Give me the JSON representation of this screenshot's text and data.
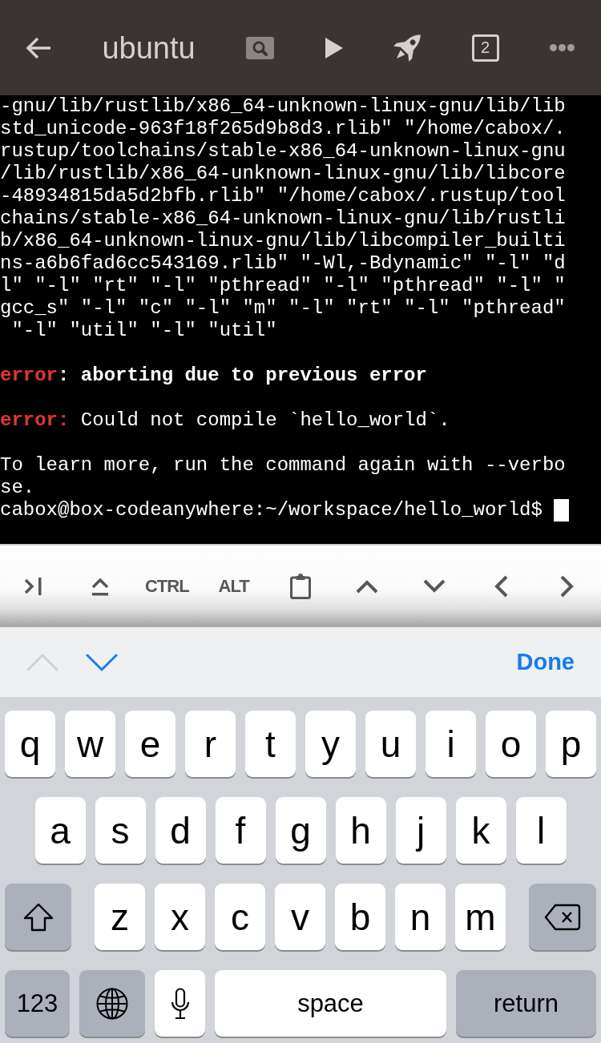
{
  "top_bar": {
    "title": "ubuntu",
    "tab_count": "2"
  },
  "terminal": {
    "blocks": [
      {
        "lines": [
          {
            "kind": "output",
            "text": "-gnu/lib/rustlib/x86_64-unknown-linux-gnu/lib/lib"
          },
          {
            "kind": "output",
            "text": "std_unicode-963f18f265d9b8d3.rlib\" \"/home/cabox/."
          },
          {
            "kind": "output",
            "text": "rustup/toolchains/stable-x86_64-unknown-linux-gnu"
          },
          {
            "kind": "output",
            "text": "/lib/rustlib/x86_64-unknown-linux-gnu/lib/libcore"
          },
          {
            "kind": "output",
            "text": "-48934815da5d2bfb.rlib\" \"/home/cabox/.rustup/tool"
          },
          {
            "kind": "output",
            "text": "chains/stable-x86_64-unknown-linux-gnu/lib/rustli"
          },
          {
            "kind": "output",
            "text": "b/x86_64-unknown-linux-gnu/lib/libcompiler_builti"
          },
          {
            "kind": "output",
            "text": "ns-a6b6fad6cc543169.rlib\" \"-Wl,-Bdynamic\" \"-l\" \"d"
          },
          {
            "kind": "output",
            "text": "l\" \"-l\" \"rt\" \"-l\" \"pthread\" \"-l\" \"pthread\" \"-l\" \""
          },
          {
            "kind": "output",
            "text": "gcc_s\" \"-l\" \"c\" \"-l\" \"m\" \"-l\" \"rt\" \"-l\" \"pthread\""
          },
          {
            "kind": "output",
            "text": " \"-l\" \"util\" \"-l\" \"util\""
          }
        ]
      },
      {
        "lines": [
          {
            "kind": "error",
            "label": "error",
            "message": ": aborting due to previous error",
            "bold": true
          }
        ]
      },
      {
        "lines": [
          {
            "kind": "error",
            "label": "error:",
            "message": " Could not compile `hello_world`.",
            "bold": false
          }
        ]
      },
      {
        "lines": [
          {
            "kind": "output",
            "text": "To learn more, run the command again with --verbo"
          },
          {
            "kind": "output",
            "text": "se."
          },
          {
            "kind": "prompt",
            "text": "cabox@box-codeanywhere:~/workspace/hello_world$",
            "cursor": true
          }
        ]
      }
    ]
  },
  "terminal_toolbar": {
    "modifier_keys": [
      {
        "label": "CTRL"
      },
      {
        "label": "ALT"
      }
    ]
  },
  "form_bar": {
    "previous": {
      "disabled": true
    },
    "next": {
      "disabled": false
    },
    "done": "Done"
  },
  "keyboard": {
    "rows": [
      {
        "keys": [
          {
            "kind": "letter",
            "label": "q"
          },
          {
            "kind": "letter",
            "label": "w"
          },
          {
            "kind": "letter",
            "label": "e"
          },
          {
            "kind": "letter",
            "label": "r"
          },
          {
            "kind": "letter",
            "label": "t"
          },
          {
            "kind": "letter",
            "label": "y"
          },
          {
            "kind": "letter",
            "label": "u"
          },
          {
            "kind": "letter",
            "label": "i"
          },
          {
            "kind": "letter",
            "label": "o"
          },
          {
            "kind": "letter",
            "label": "p"
          }
        ]
      },
      {
        "keys": [
          {
            "kind": "letter",
            "label": "a"
          },
          {
            "kind": "letter",
            "label": "s"
          },
          {
            "kind": "letter",
            "label": "d"
          },
          {
            "kind": "letter",
            "label": "f"
          },
          {
            "kind": "letter",
            "label": "g"
          },
          {
            "kind": "letter",
            "label": "h"
          },
          {
            "kind": "letter",
            "label": "j"
          },
          {
            "kind": "letter",
            "label": "k"
          },
          {
            "kind": "letter",
            "label": "l"
          }
        ]
      },
      {
        "keys": [
          {
            "kind": "shift",
            "on": false
          },
          {
            "kind": "letter",
            "label": "z"
          },
          {
            "kind": "letter",
            "label": "x"
          },
          {
            "kind": "letter",
            "label": "c"
          },
          {
            "kind": "letter",
            "label": "v"
          },
          {
            "kind": "letter",
            "label": "b"
          },
          {
            "kind": "letter",
            "label": "n"
          },
          {
            "kind": "letter",
            "label": "m"
          },
          {
            "kind": "delete"
          }
        ]
      },
      {
        "keys": [
          {
            "kind": "mode",
            "label": "123"
          },
          {
            "kind": "globe"
          },
          {
            "kind": "dictation"
          },
          {
            "kind": "space",
            "label": "space"
          },
          {
            "kind": "return",
            "label": "return"
          }
        ]
      }
    ]
  }
}
